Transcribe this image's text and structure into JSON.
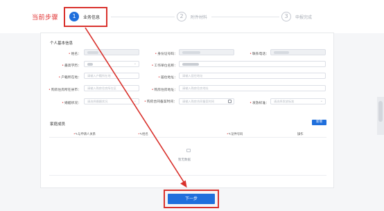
{
  "annotation": {
    "current_step_label": "当前步骤"
  },
  "steps": [
    {
      "num": "1",
      "label": "业务信息"
    },
    {
      "num": "2",
      "label": "附件材料"
    },
    {
      "num": "3",
      "label": "申报完成"
    }
  ],
  "section_basic": {
    "title": "个人基本信息"
  },
  "fields": {
    "name": {
      "label": "姓名："
    },
    "id_no": {
      "label": "身份证号码："
    },
    "phone": {
      "label": "联系电话："
    },
    "education": {
      "label": "最高学历："
    },
    "work_unit": {
      "label": "工作单位名称："
    },
    "household": {
      "label": "户籍所在地：",
      "placeholder": "请输入户籍所在地"
    },
    "residence": {
      "label": "居住地址：",
      "placeholder": "请输入居住地址"
    },
    "house_district": {
      "label": "购房住房所在县市：",
      "placeholder": "请输入购房住房所在区"
    },
    "house_address": {
      "label": "购房住房地址：",
      "placeholder": "请输入购房住房地址"
    },
    "marital": {
      "label": "婚姻状况：",
      "placeholder": "请选择婚姻状况"
    },
    "contract_time": {
      "label": "购房合同备案时间：",
      "placeholder": "请输入购房合同备案时间"
    },
    "subsidy": {
      "label": "发放标准：",
      "placeholder": "请选择发放标准"
    }
  },
  "family": {
    "title": "家庭成员",
    "add_label": "新增",
    "columns": [
      "与申请人关系",
      "姓名",
      "证件号码",
      "操作"
    ],
    "empty_text": "暂无数据"
  },
  "next_label": "下一步",
  "colors": {
    "primary": "#1f6fdc",
    "highlight": "#d9312c"
  }
}
